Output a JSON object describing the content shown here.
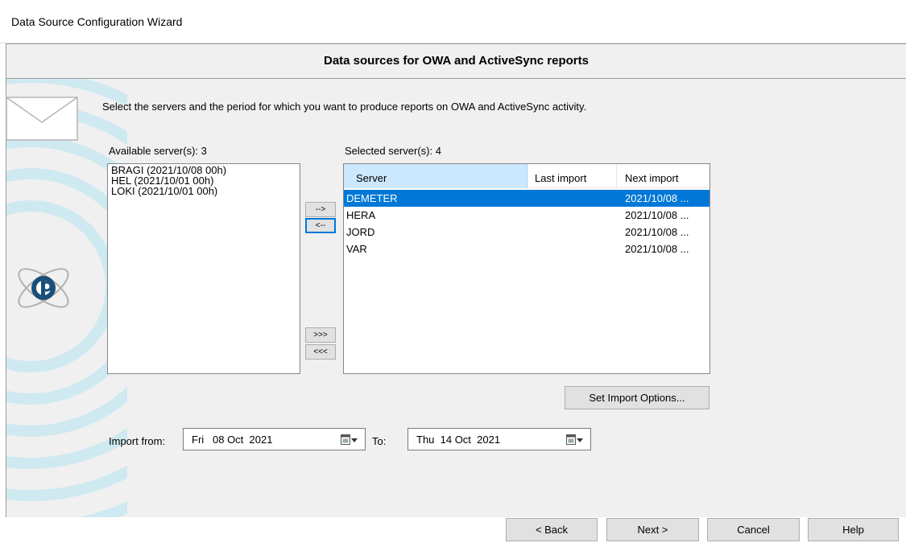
{
  "window": {
    "title": "Data Source Configuration Wizard"
  },
  "header": {
    "title": "Data sources for OWA and ActiveSync reports"
  },
  "instruction": "Select the servers and the period for which you want to produce reports on OWA and ActiveSync activity.",
  "available": {
    "label": "Available server(s): 3",
    "items": [
      "BRAGI (2021/10/08 00h)",
      "HEL (2021/10/01 00h)",
      "LOKI (2021/10/01 00h)"
    ]
  },
  "selected": {
    "label": "Selected server(s): 4",
    "columns": [
      "Server",
      "Last import",
      "Next import"
    ],
    "rows": [
      {
        "server": "DEMETER",
        "last_import": "",
        "next_import": "2021/10/08 ..."
      },
      {
        "server": "HERA",
        "last_import": "",
        "next_import": "2021/10/08 ..."
      },
      {
        "server": "JORD",
        "last_import": "",
        "next_import": "2021/10/08 ..."
      },
      {
        "server": "VAR",
        "last_import": "",
        "next_import": "2021/10/08 ..."
      }
    ],
    "selected_row": 0
  },
  "transfer": {
    "add": "-->",
    "remove": "<--",
    "add_all": ">>>",
    "remove_all": "<<<"
  },
  "import_options_button": "Set Import Options...",
  "import_from": {
    "label": "Import from:",
    "value": "Fri   08 Oct  2021"
  },
  "import_to": {
    "label": "To:",
    "value": "Thu  14 Oct  2021"
  },
  "nav": {
    "back": "< Back",
    "next": "Next >",
    "cancel": "Cancel",
    "help": "Help"
  },
  "colors": {
    "accent": "#0078d7",
    "header_highlight": "#cce8ff",
    "panel": "#f0f0f0",
    "swirl": "#a9d8e4"
  }
}
